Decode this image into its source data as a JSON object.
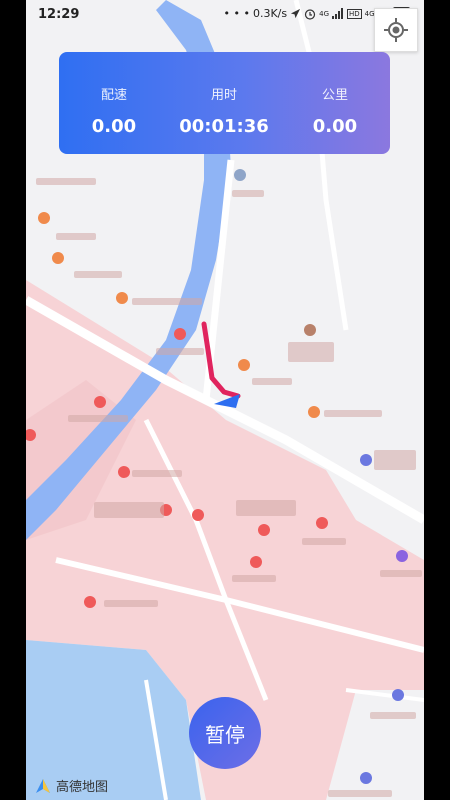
{
  "status_bar": {
    "time": "12:29",
    "net_speed": "0.3K/s",
    "signal_1": "4G",
    "hd": "HD",
    "signal_2": "4G",
    "battery": "75"
  },
  "stats_panel": {
    "speed_label": "配速",
    "speed_value": "0.00",
    "time_label": "用时",
    "time_value": "00:01:36",
    "distance_label": "公里",
    "distance_value": "0.00"
  },
  "pause_button": {
    "label": "暂停"
  },
  "map_logo": {
    "text": "高德地图"
  },
  "icons": [
    "locate-icon",
    "location-arrow-icon",
    "alarm-icon",
    "signal-icon",
    "battery-icon"
  ],
  "colors": {
    "panel_gradient_start": "#2f6ff2",
    "panel_gradient_end": "#8b78df",
    "track": "#e0245e",
    "river": "#8fb4f5",
    "lake": "#a9cdf3",
    "pink_area": "#f7d3d6",
    "poi_orange": "#f08a4b",
    "poi_red": "#ef5a5a",
    "poi_purple": "#8a63e0"
  }
}
